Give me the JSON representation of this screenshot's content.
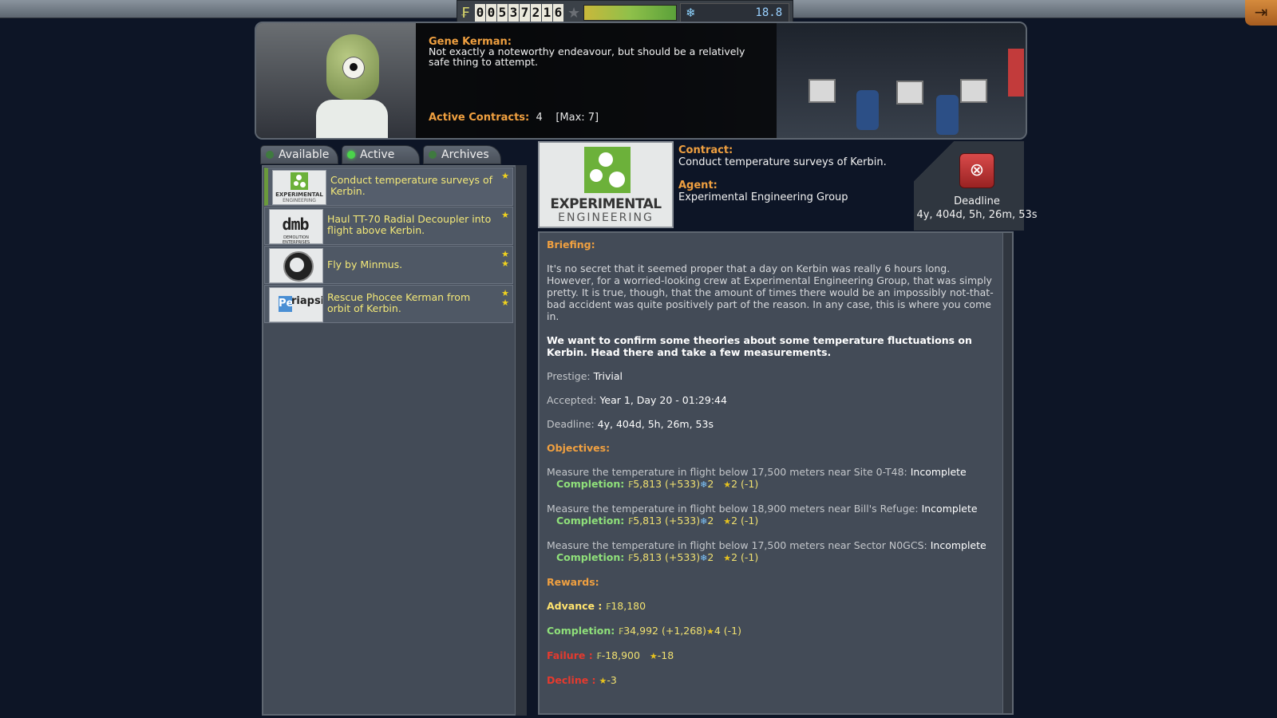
{
  "topbar": {
    "funds_digits": [
      "0",
      "0",
      "5",
      "3",
      "7",
      "2",
      "1",
      "6"
    ],
    "funds_icon": "kerbal-funds-icon",
    "reputation_icon": "star-icon",
    "reputation_level": 0.55,
    "science_icon": "science-icon",
    "science_value": "18.8",
    "exit_icon": "exit-door-icon"
  },
  "header": {
    "speaker": "Gene Kerman:",
    "quote": "Not exactly a noteworthy endeavour, but should be a relatively safe thing to attempt.",
    "active_label": "Active Contracts:",
    "active_count": "4",
    "active_max": "[Max: 7]"
  },
  "tabs": [
    {
      "label": "Available",
      "active": false
    },
    {
      "label": "Active",
      "active": true
    },
    {
      "label": "Archives",
      "active": false
    }
  ],
  "contracts": [
    {
      "title": "Conduct temperature surveys of Kerbin.",
      "agency": "experimental-engineering-logo",
      "stars": 1
    },
    {
      "title": "Haul TT-70 Radial Decoupler into flight above Kerbin.",
      "agency": "demolition-enterprises-logo",
      "stars": 1
    },
    {
      "title": "Fly by Minmus.",
      "agency": "seal-logo",
      "stars": 2
    },
    {
      "title": "Rescue Phocee Kerman from orbit of Kerbin.",
      "agency": "periapsis-logo",
      "stars": 2
    }
  ],
  "logos": {
    "experimental_top": "EXPERIMENTAL",
    "experimental_bottom": "ENGINEERING",
    "dmb": "dmb",
    "dmb_sub": "DEMOLITION ENTERPRISES",
    "periapsis_pe": "Pe",
    "periapsis_rest": "riapsis"
  },
  "detail": {
    "contract_label": "Contract:",
    "contract_value": "Conduct temperature surveys of Kerbin.",
    "agent_label": "Agent:",
    "agent_value": "Experimental Engineering Group",
    "deadline_label": "Deadline",
    "deadline_value": "4y, 404d, 5h, 26m, 53s",
    "cancel_icon": "cancel-x-icon",
    "briefing_label": "Briefing:",
    "briefing_text": "It's no secret that it seemed proper that a day on Kerbin was really 6 hours long. However, for a worried-looking crew at Experimental Engineering Group, that was simply pretty. It is true, though, that the amount of times there would be an impossibly not-that-bad accident was quite positively part of the reason. In any case, this is where you come in.",
    "synopsis": "We want to confirm some theories about some temperature fluctuations on Kerbin. Head there and take a few measurements.",
    "prestige_label": "Prestige:",
    "prestige_value": "Trivial",
    "accepted_label": "Accepted:",
    "accepted_value": "Year 1, Day 20 - 01:29:44",
    "deadline_line_label": "Deadline:",
    "deadline_line_value": "4y, 404d, 5h, 26m, 53s",
    "objectives_label": "Objectives:",
    "objectives": [
      {
        "title": "Measure the temperature in flight below 17,500 meters near Site 0-T48:",
        "status": "Incomplete",
        "funds": "5,813",
        "funds_bonus": "(+533)",
        "science": "2",
        "rep": "2",
        "rep_bonus": "(-1)"
      },
      {
        "title": "Measure the temperature in flight below 18,900 meters near Bill's Refuge:",
        "status": "Incomplete",
        "funds": "5,813",
        "funds_bonus": "(+533)",
        "science": "2",
        "rep": "2",
        "rep_bonus": "(-1)"
      },
      {
        "title": "Measure the temperature in flight below 17,500 meters near Sector N0GCS:",
        "status": "Incomplete",
        "funds": "5,813",
        "funds_bonus": "(+533)",
        "science": "2",
        "rep": "2",
        "rep_bonus": "(-1)"
      }
    ],
    "completion_label": "Completion:",
    "rewards_label": "Rewards:",
    "advance_label": "Advance  :",
    "advance_funds": "18,180",
    "completion_funds": "34,992",
    "completion_funds_bonus": "(+1,268)",
    "completion_rep": "4",
    "completion_rep_bonus": "(-1)",
    "failure_label": "Failure  :",
    "failure_funds": "-18,900",
    "failure_rep": "-18",
    "decline_label": "Decline  :",
    "decline_rep": "-3"
  }
}
